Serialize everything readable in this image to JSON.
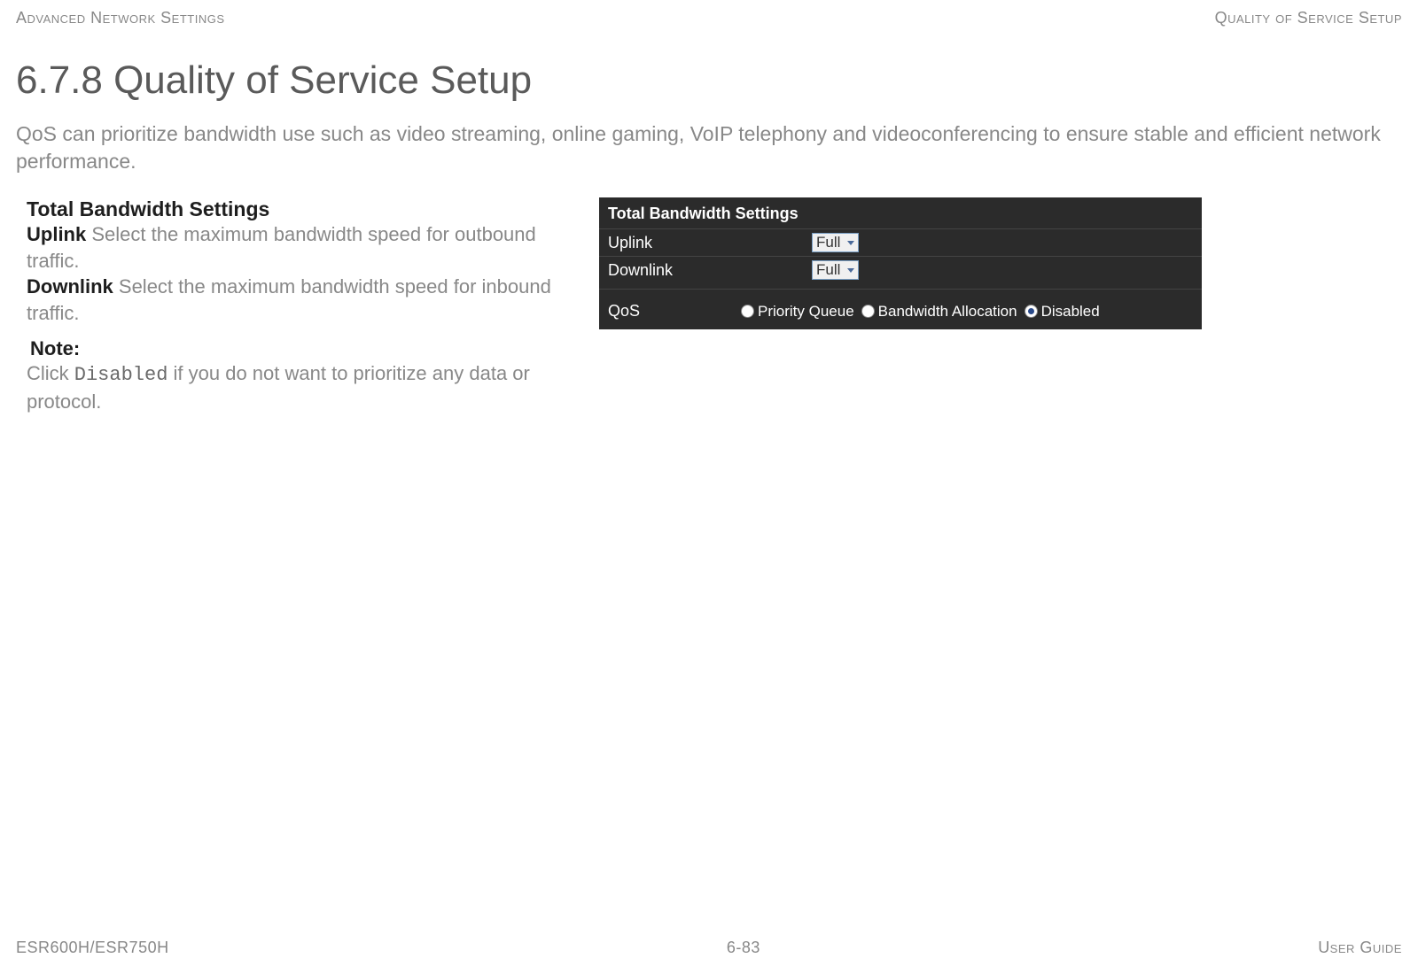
{
  "header": {
    "left": "Advanced Network Settings",
    "right": "Quality of Service Setup"
  },
  "section_title": "6.7.8 Quality of Service Setup",
  "intro": "QoS can prioritize bandwidth use such as video streaming, online gaming, VoIP telephony and videoconferencing to ensure stable and efficient network performance.",
  "definitions": {
    "heading": "Total Bandwidth Settings",
    "uplink_term": "Uplink",
    "uplink_text": "  Select the maximum bandwidth speed for outbound traffic.",
    "downlink_term": "Downlink",
    "downlink_text": "  Select the maximum bandwidth speed for inbound traffic."
  },
  "note": {
    "label": "Note:",
    "pre": "Click ",
    "mono": "Disabled",
    "post": " if you do not want to prioritize any data or protocol."
  },
  "ui": {
    "panel_title": "Total Bandwidth Settings",
    "uplink_label": "Uplink",
    "uplink_value": "Full",
    "downlink_label": "Downlink",
    "downlink_value": "Full",
    "qos_label": "QoS",
    "radio_priority": "Priority Queue",
    "radio_bandwidth": "Bandwidth Allocation",
    "radio_disabled": "Disabled"
  },
  "footer": {
    "left": "ESR600H/ESR750H",
    "center": "6-83",
    "right": "User Guide"
  }
}
